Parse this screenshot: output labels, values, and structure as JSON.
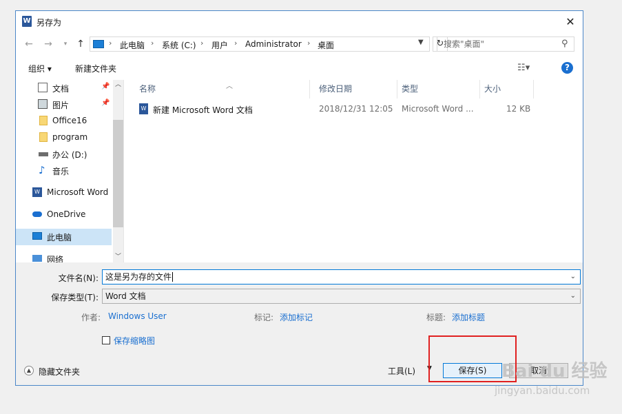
{
  "window": {
    "title": "另存为",
    "app_icon_letter": "W"
  },
  "nav": {
    "crumbs": [
      "此电脑",
      "系统 (C:)",
      "用户",
      "Administrator",
      "桌面"
    ],
    "search_placeholder": "搜索\"桌面\""
  },
  "toolbar": {
    "organize": "组织 ▾",
    "new_folder": "新建文件夹"
  },
  "sidebar": {
    "items": [
      {
        "label": "文档",
        "icon": "document-icon"
      },
      {
        "label": "图片",
        "icon": "picture-icon"
      },
      {
        "label": "Office16",
        "icon": "folder-icon"
      },
      {
        "label": "program",
        "icon": "folder-icon"
      },
      {
        "label": "办公 (D:)",
        "icon": "drive-icon"
      },
      {
        "label": "音乐",
        "icon": "music-icon"
      },
      {
        "label": "Microsoft Word",
        "icon": "word-icon"
      },
      {
        "label": "OneDrive",
        "icon": "cloud-icon"
      },
      {
        "label": "此电脑",
        "icon": "computer-icon"
      },
      {
        "label": "网络",
        "icon": "network-icon"
      }
    ]
  },
  "table": {
    "headers": {
      "name": "名称",
      "date": "修改日期",
      "type": "类型",
      "size": "大小"
    },
    "rows": [
      {
        "name": "新建 Microsoft Word 文档",
        "date": "2018/12/31 12:05",
        "type": "Microsoft Word ...",
        "size": "12 KB"
      }
    ]
  },
  "form": {
    "filename_label": "文件名(N):",
    "filename_value": "这是另为存的文件",
    "filetype_label": "保存类型(T):",
    "filetype_value": "Word 文档",
    "author_label": "作者:",
    "author_value": "Windows User",
    "tags_label": "标记:",
    "tags_value": "添加标记",
    "title_label": "标题:",
    "title_value": "添加标题",
    "thumbnail_label": "保存缩略图"
  },
  "footer": {
    "hide_folders": "隐藏文件夹",
    "tools": "工具(L)",
    "save": "保存(S)",
    "cancel": "取消"
  },
  "watermark": {
    "brand": "Bai du 经验",
    "url": "jingyan.baidu.com"
  },
  "colors": {
    "accent": "#0078d7",
    "highlight": "#e02020",
    "selected": "#cce4f7"
  }
}
